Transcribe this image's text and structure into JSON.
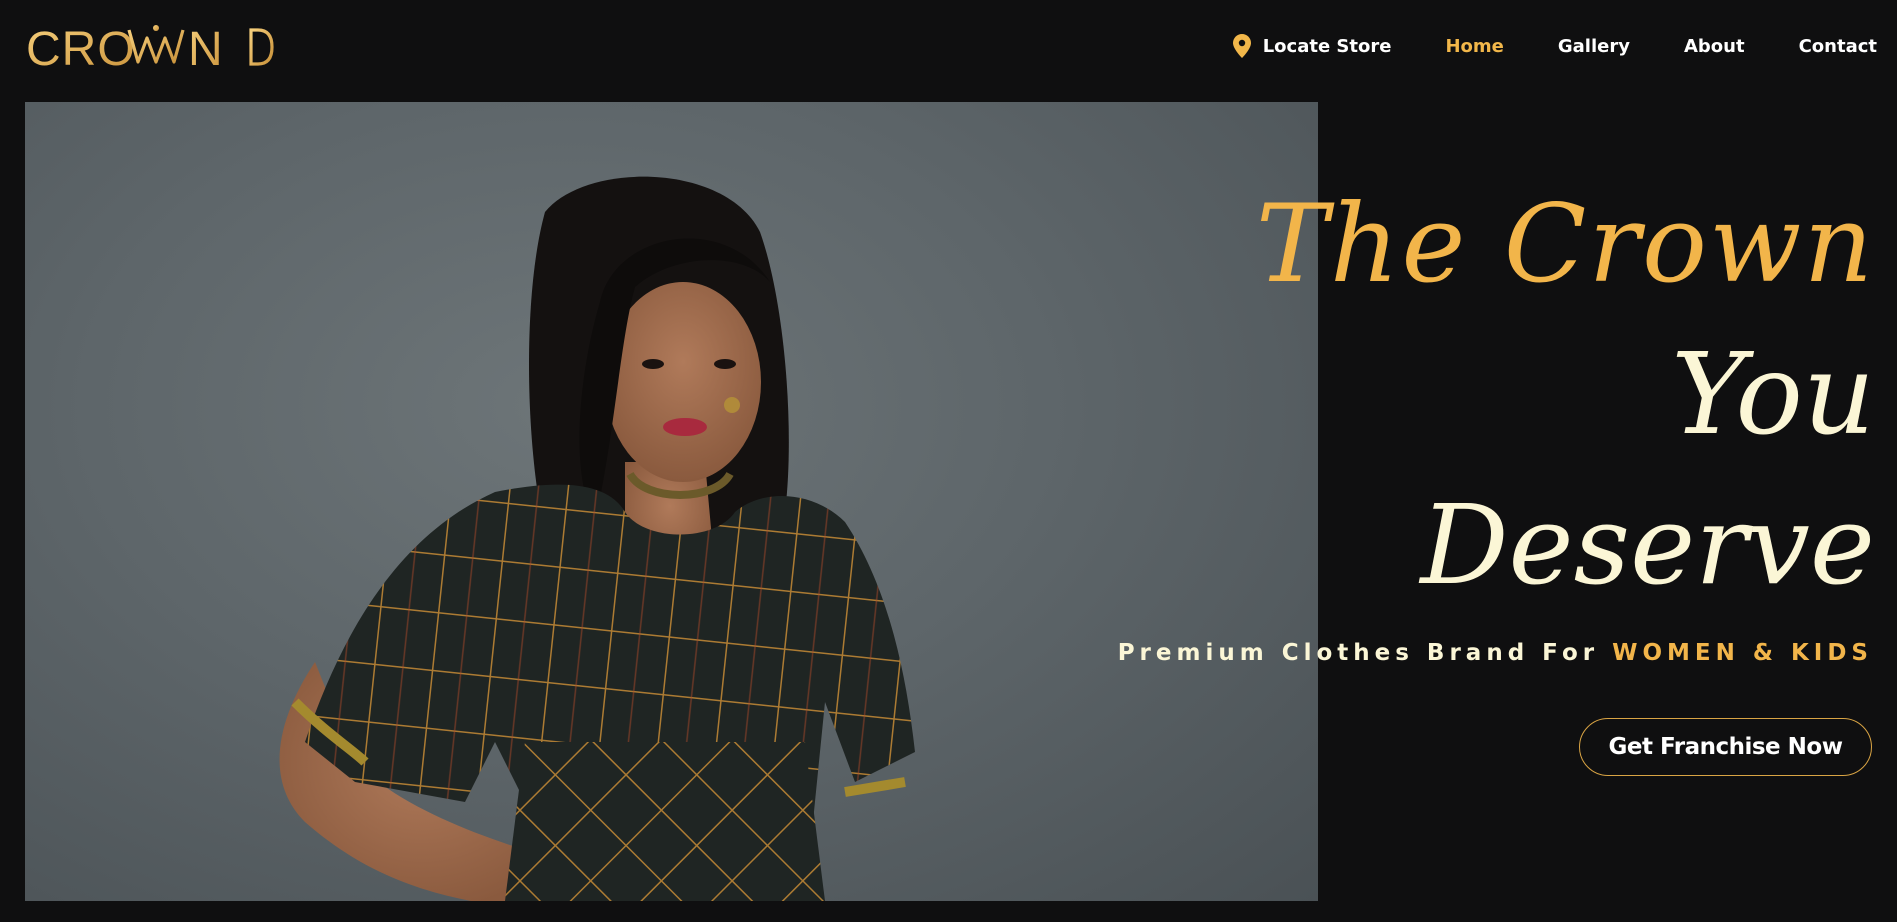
{
  "brand": {
    "logo_text": "CROWNED",
    "colors": {
      "gold": "#f2b54a",
      "cream": "#fbf6d6",
      "background": "#0f0f10"
    }
  },
  "nav": {
    "items": [
      {
        "label": "Locate Store",
        "icon": "location-pin-icon",
        "active": false
      },
      {
        "label": "Home",
        "active": true
      },
      {
        "label": "Gallery",
        "active": false
      },
      {
        "label": "About",
        "active": false
      },
      {
        "label": "Contact",
        "active": false
      }
    ]
  },
  "hero": {
    "headline_line1": "The Crown",
    "headline_line2": "You",
    "headline_line3": "Deserve",
    "subtitle_main": "Premium Clothes Brand For",
    "subtitle_highlight": "WOMEN & KIDS",
    "cta_label": "Get Franchise Now"
  }
}
